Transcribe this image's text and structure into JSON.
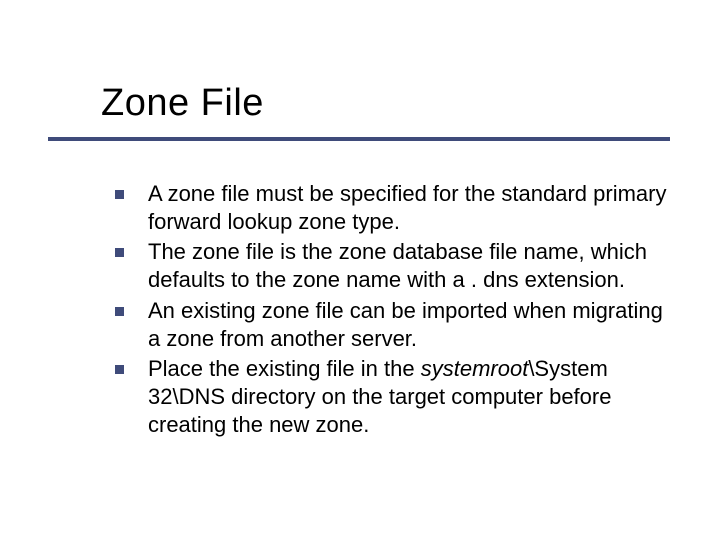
{
  "slide": {
    "title": "Zone File",
    "bullets": [
      {
        "text": "A zone file must be specified for the standard primary forward lookup zone type."
      },
      {
        "text": "The zone file is the zone database file name, which defaults to the zone name with a . dns extension."
      },
      {
        "text": "An existing zone file can be imported when migrating a zone from another server."
      },
      {
        "prefix": "Place the existing file in the ",
        "italic": "systemroot",
        "suffix": "\\System 32\\DNS directory on the target computer before creating the new zone."
      }
    ]
  }
}
